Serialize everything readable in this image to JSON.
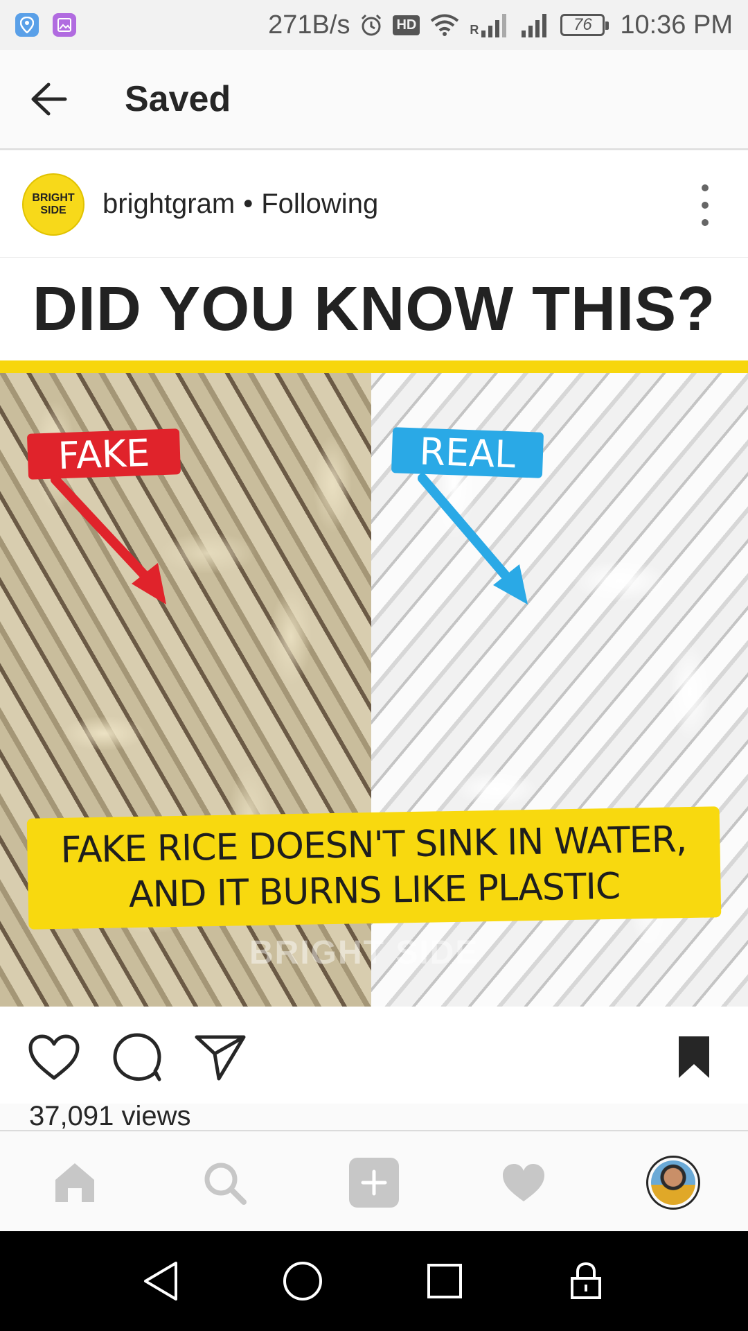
{
  "status_bar": {
    "network_speed": "271B/s",
    "hd_label": "HD",
    "carrier_label": "R",
    "battery": "76",
    "time": "10:36 PM",
    "icons": [
      "location-app-icon",
      "gallery-app-icon",
      "alarm-icon",
      "wifi-icon",
      "signal-icon",
      "signal-icon",
      "battery-icon"
    ]
  },
  "header": {
    "title": "Saved"
  },
  "post": {
    "avatar_text_line1": "BRIGHT",
    "avatar_text_line2": "SIDE",
    "username": "brightgram",
    "separator": "•",
    "follow_status": "Following",
    "image": {
      "headline": "DID YOU KNOW THIS?",
      "tag_left": "FAKE",
      "tag_right": "REAL",
      "caption_line1": "FAKE RICE DOESN'T SINK IN WATER,",
      "caption_line2": "AND IT BURNS LIKE PLASTIC",
      "watermark": "BRIGHT SIDE",
      "colors": {
        "fake": "#e0232b",
        "real": "#2aa9e6",
        "band": "#f8d90f"
      }
    },
    "views": "37,091 views"
  },
  "actions": [
    "heart-icon",
    "comment-icon",
    "share-icon",
    "bookmark-icon"
  ],
  "bottom_nav": [
    "home-icon",
    "search-icon",
    "add-icon",
    "activity-heart-icon",
    "profile-avatar"
  ],
  "system_nav": [
    "back-triangle-icon",
    "home-circle-icon",
    "recents-square-icon",
    "lock-icon"
  ]
}
